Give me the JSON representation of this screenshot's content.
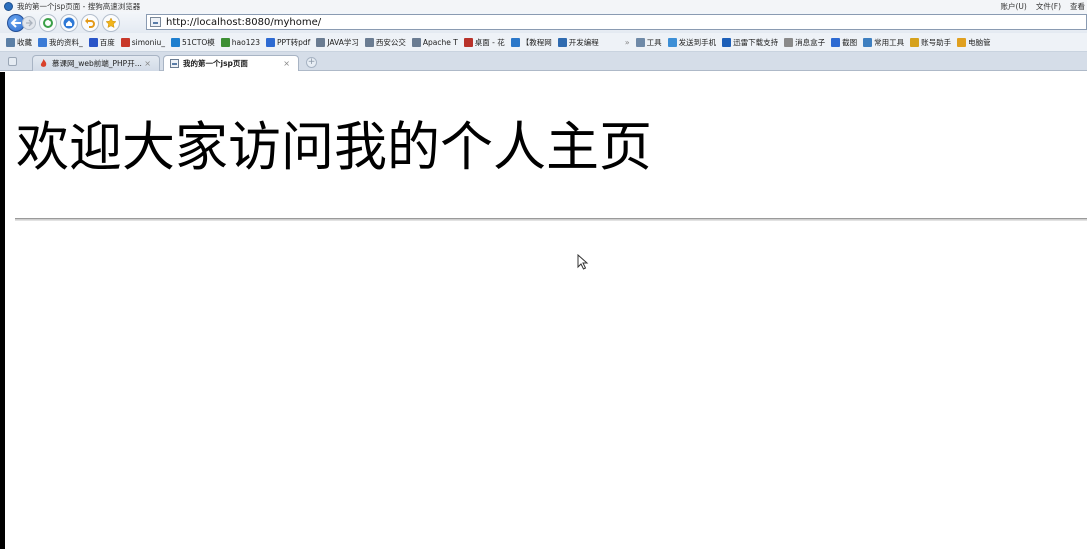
{
  "window": {
    "title": "我的第一个jsp页面 - 搜狗高速浏览器",
    "menu": [
      "账户(U)",
      "文件(F)",
      "查看"
    ]
  },
  "navigation": {
    "url": "http://localhost:8080/myhome/"
  },
  "bookmarks": [
    {
      "label": "收藏",
      "icon": "star-plus-icon",
      "color": "#5b7fa6"
    },
    {
      "label": "我的资料_",
      "icon": "profile-icon",
      "color": "#3b7bd6"
    },
    {
      "label": "百度",
      "icon": "paw-icon",
      "color": "#2a55c8"
    },
    {
      "label": "simoniu_",
      "icon": "mascot-icon",
      "color": "#c8382a"
    },
    {
      "label": "51CTO模",
      "icon": "cto-icon",
      "color": "#1f7fcf"
    },
    {
      "label": "hao123",
      "icon": "hao123-icon",
      "color": "#3d8f34"
    },
    {
      "label": "PPT转pdf",
      "icon": "ppt-icon",
      "color": "#2d6ad2"
    },
    {
      "label": "JAVA学习",
      "icon": "doc-icon",
      "color": "#6a7c92"
    },
    {
      "label": "西安公交",
      "icon": "doc-icon",
      "color": "#6a7c92"
    },
    {
      "label": "Apache T",
      "icon": "page-icon",
      "color": "#6a7c92"
    },
    {
      "label": "桌面 - 花",
      "icon": "flower-icon",
      "color": "#b8322a"
    },
    {
      "label": "【教程网",
      "icon": "bird-icon",
      "color": "#2a77c9"
    },
    {
      "label": "开发编程",
      "icon": "code-icon",
      "color": "#2f6bb0"
    }
  ],
  "toolbar_right": [
    {
      "label": "工具",
      "icon": "tools-icon",
      "color": "#6f8aa8"
    },
    {
      "label": "发送到手机",
      "icon": "phone-icon",
      "color": "#3d8fd6"
    },
    {
      "label": "迅雷下载支持",
      "icon": "thunder-icon",
      "color": "#1d5fb8"
    },
    {
      "label": "消息盒子",
      "icon": "message-icon",
      "color": "#8a8a8a"
    },
    {
      "label": "截图",
      "icon": "screenshot-icon",
      "color": "#2d6ad2"
    },
    {
      "label": "常用工具",
      "icon": "wrench-icon",
      "color": "#3e7fc0"
    },
    {
      "label": "账号助手",
      "icon": "key-icon",
      "color": "#d6a21e"
    },
    {
      "label": "电脑管",
      "icon": "shield-icon",
      "color": "#e0a020"
    }
  ],
  "tabs": [
    {
      "label": "慕课网_web前端_PHP开...",
      "icon": "flame-icon",
      "color": "#d9412b"
    },
    {
      "label": "我的第一个jsp页面",
      "icon": "page-icon",
      "color": "#6a7c92"
    }
  ],
  "page": {
    "heading": "欢迎大家访问我的个人主页"
  }
}
